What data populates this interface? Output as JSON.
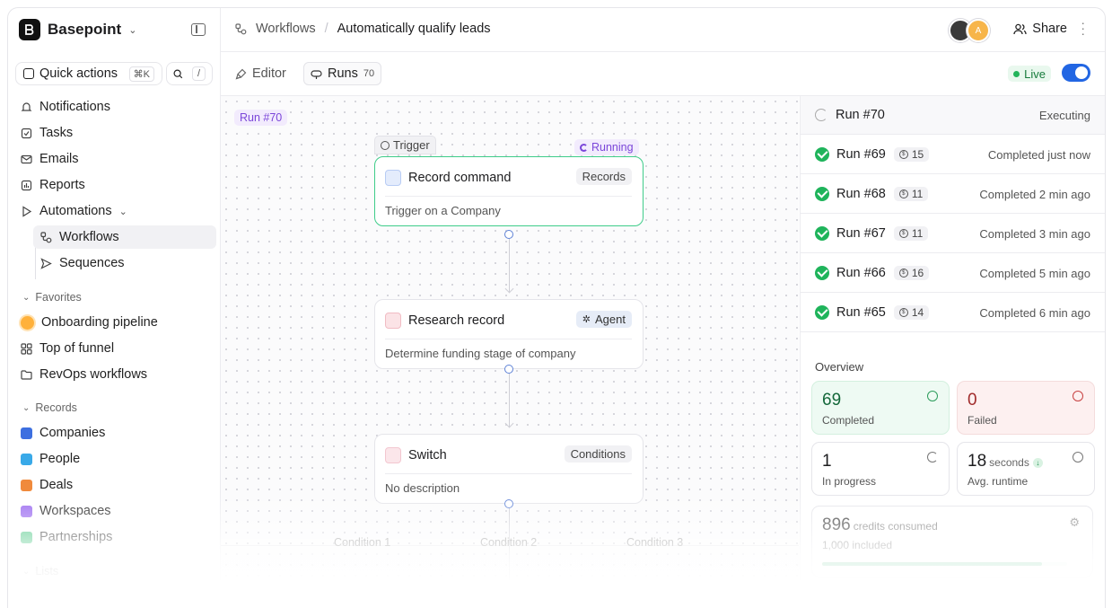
{
  "sidebar": {
    "brand": "Basepoint",
    "quick_actions": "Quick actions",
    "quick_shortcut": "⌘K",
    "search_shortcut": "/",
    "nav": [
      "Notifications",
      "Tasks",
      "Emails",
      "Reports",
      "Automations"
    ],
    "automations_sub": [
      "Workflows",
      "Sequences"
    ],
    "favorites_title": "Favorites",
    "favorites": [
      "Onboarding pipeline",
      "Top of funnel",
      "RevOps workflows"
    ],
    "records_title": "Records",
    "records": [
      "Companies",
      "People",
      "Deals",
      "Workspaces",
      "Partnerships"
    ],
    "lists_title": "Lists"
  },
  "header": {
    "crumb_root": "Workflows",
    "crumb_current": "Automatically qualify leads",
    "avatar_letter": "A",
    "share": "Share"
  },
  "tabs": {
    "editor": "Editor",
    "runs": "Runs",
    "runs_count": "70",
    "live": "Live"
  },
  "canvas": {
    "run_tag": "Run #70",
    "trigger_tag": "Trigger",
    "running_tag": "Running",
    "nodes": [
      {
        "title": "Record command",
        "badge": "Records",
        "desc": "Trigger on a Company"
      },
      {
        "title": "Research record",
        "badge": "Agent",
        "desc": "Determine funding stage of company"
      },
      {
        "title": "Switch",
        "badge": "Conditions",
        "desc": "No description"
      }
    ],
    "conditions": [
      "Condition 1",
      "Condition 2",
      "Condition 3"
    ]
  },
  "runs": [
    {
      "name": "Run #70",
      "credits": "",
      "status": "Executing"
    },
    {
      "name": "Run #69",
      "credits": "15",
      "status": "Completed just now"
    },
    {
      "name": "Run #68",
      "credits": "11",
      "status": "Completed 2 min ago"
    },
    {
      "name": "Run #67",
      "credits": "11",
      "status": "Completed 3 min ago"
    },
    {
      "name": "Run #66",
      "credits": "16",
      "status": "Completed 5 min ago"
    },
    {
      "name": "Run #65",
      "credits": "14",
      "status": "Completed 6 min ago"
    }
  ],
  "overview": {
    "title": "Overview",
    "completed": {
      "value": "69",
      "label": "Completed"
    },
    "failed": {
      "value": "0",
      "label": "Failed"
    },
    "in_progress": {
      "value": "1",
      "label": "In progress"
    },
    "runtime": {
      "value": "18",
      "unit": "seconds",
      "label": "Avg. runtime"
    },
    "credits": {
      "value": "896",
      "unit": "credits consumed",
      "label": "1,000 included",
      "fraction": 0.896
    }
  },
  "colors": {
    "accent": "#2266e3",
    "success": "#1fb45b",
    "running": "#7b46d9",
    "danger": "#c84141"
  }
}
